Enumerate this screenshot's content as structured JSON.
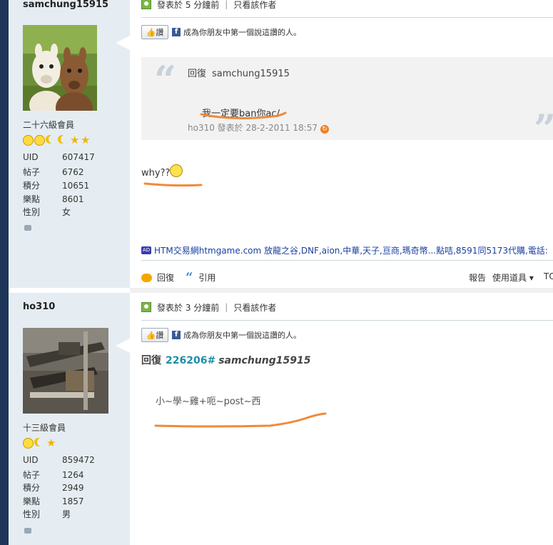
{
  "posts": [
    {
      "author": {
        "name": "samchung15915",
        "rank": "二十六級會員",
        "badges": [
          "sun",
          "sun",
          "moon",
          "moon",
          "star",
          "star"
        ],
        "stats": [
          {
            "label": "UID",
            "value": "607417"
          },
          {
            "label": "帖子",
            "value": "6762"
          },
          {
            "label": "積分",
            "value": "10651"
          },
          {
            "label": "樂點",
            "value": "8601"
          },
          {
            "label": "性別",
            "value": "女"
          }
        ]
      },
      "meta": {
        "posted": "發表於 5 分鐘前",
        "sep": "|",
        "author_only": "只看該作者"
      },
      "like": {
        "button": "讚",
        "text": "成為你朋友中第一個說這讚的人。"
      },
      "quote": {
        "reply_label": "回復",
        "reply_to": "samchung15915",
        "text": "我一定要ban你ac/",
        "meta": "ho310 發表於 28-2-2011 18:57"
      },
      "body": "why??"
    },
    {
      "author": {
        "name": "ho310",
        "rank": "十三級會員",
        "badges": [
          "sun",
          "moon",
          "star"
        ],
        "stats": [
          {
            "label": "UID",
            "value": "859472"
          },
          {
            "label": "帖子",
            "value": "1264"
          },
          {
            "label": "積分",
            "value": "2949"
          },
          {
            "label": "樂點",
            "value": "1857"
          },
          {
            "label": "性別",
            "value": "男"
          }
        ]
      },
      "meta": {
        "posted": "發表於 3 分鐘前",
        "sep": "|",
        "author_only": "只看該作者"
      },
      "like": {
        "button": "讚",
        "text": "成為你朋友中第一個說這讚的人。"
      },
      "reply": {
        "label": "回復",
        "post_id": "226206#",
        "user": "samchung15915"
      },
      "body": "小~學~雞+呃~post~西"
    }
  ],
  "ad": {
    "tag": "AD",
    "text": "HTM交易網htmgame.com 放龍之谷,DNF,aion,中華,天子,亘商,瑪奇幣...點咭,8591同5173代購,電話:"
  },
  "actions": {
    "reply": "回復",
    "quote": "引用",
    "report": "報告",
    "tools": "使用道具 ▾",
    "top": "TO"
  },
  "colors": {
    "sidebar": "#e5edf2",
    "leftbar": "#1e3758",
    "link": "#1a8fa8",
    "scribble": "#f08a3a"
  }
}
